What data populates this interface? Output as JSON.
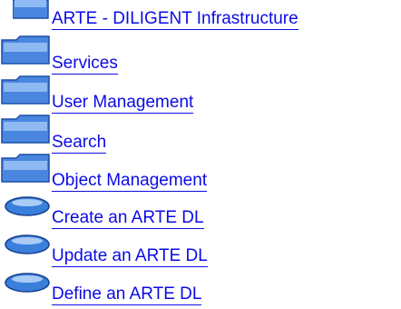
{
  "tree": {
    "items": [
      {
        "label": "ARTE - DILIGENT Infrastructure",
        "icon": "folder-icon"
      },
      {
        "label": "Services",
        "icon": "folder-icon"
      },
      {
        "label": "User Management",
        "icon": "folder-icon"
      },
      {
        "label": "Search",
        "icon": "folder-icon"
      },
      {
        "label": "Object Management",
        "icon": "folder-icon"
      },
      {
        "label": "Create an ARTE DL",
        "icon": "leaf-bullet-icon"
      },
      {
        "label": "Update an ARTE DL",
        "icon": "leaf-bullet-icon"
      },
      {
        "label": "Define an ARTE DL",
        "icon": "leaf-bullet-icon"
      }
    ]
  },
  "colors": {
    "link": "#0b0be6",
    "folder": "#3b78d8",
    "bullet": "#2f6fd0"
  }
}
